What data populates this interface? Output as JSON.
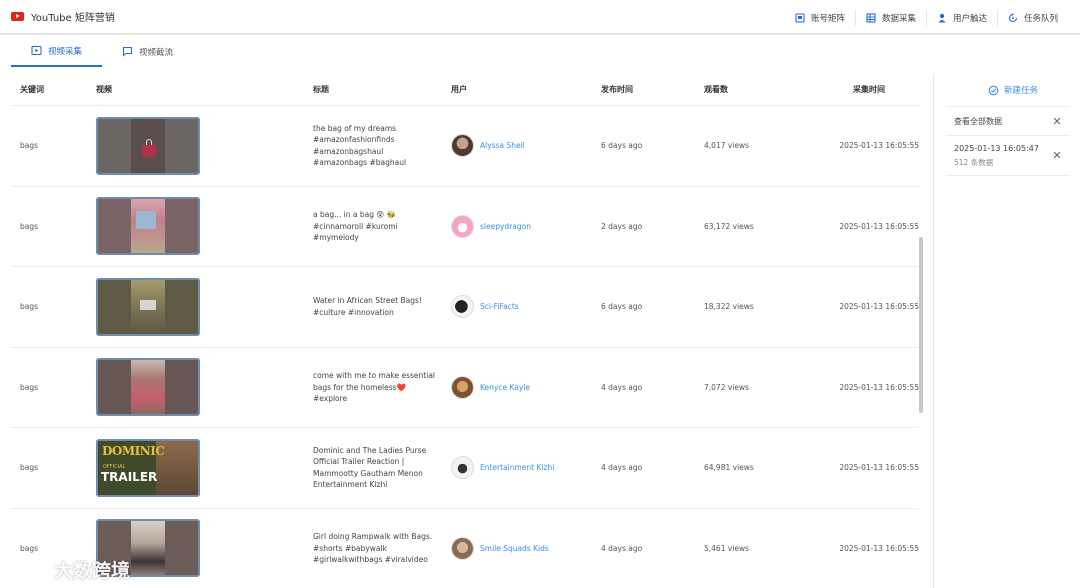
{
  "header": {
    "title": "YouTube 矩阵营销",
    "nav": [
      {
        "label": "账号矩阵",
        "icon": "account-matrix-icon"
      },
      {
        "label": "数据采集",
        "icon": "data-collection-icon"
      },
      {
        "label": "用户触达",
        "icon": "user-reach-icon"
      },
      {
        "label": "任务队列",
        "icon": "task-queue-icon"
      }
    ]
  },
  "tabs": [
    {
      "label": "视频采集",
      "icon": "video-collect-icon",
      "active": true
    },
    {
      "label": "视频截流",
      "icon": "video-intercept-icon",
      "active": false
    }
  ],
  "table": {
    "columns": [
      "关键词",
      "视频",
      "标题",
      "用户",
      "发布时间",
      "观看数",
      "采集时间"
    ],
    "rows": [
      {
        "keyword": "bags",
        "title": [
          "the bag of my dreams",
          "#amazonfashionfinds",
          "#amazonbagshaul",
          "#amazonbags #baghaul"
        ],
        "user": "Alyssa Sheil",
        "published": "6 days ago",
        "views": "4,017 views",
        "collected": "2025-01-13 16:05:55"
      },
      {
        "keyword": "bags",
        "title": [
          "a bag... in a bag 😵 🐝",
          "#cinnamoroll #kuromi",
          "#mymelody"
        ],
        "user": "sleepydragon",
        "published": "2 days ago",
        "views": "63,172 views",
        "collected": "2025-01-13 16:05:55"
      },
      {
        "keyword": "bags",
        "title": [
          "Water in African Street Bags!",
          "#culture #innovation"
        ],
        "user": "Sci-FiFacts",
        "published": "6 days ago",
        "views": "18,322 views",
        "collected": "2025-01-13 16:05:55"
      },
      {
        "keyword": "bags",
        "title": [
          "come with me to make essential",
          "bags for the homeless❤️",
          "#explore"
        ],
        "user": "Kenyce Kayle",
        "published": "4 days ago",
        "views": "7,072 views",
        "collected": "2025-01-13 16:05:55"
      },
      {
        "keyword": "bags",
        "title": [
          "Dominic and The Ladies Purse",
          "Official Trailer Reaction |",
          "Mammootty Gautham Menon",
          "Entertainment Kizhi"
        ],
        "user": "Entertainment Kizhi",
        "published": "4 days ago",
        "views": "64,981 views",
        "collected": "2025-01-13 16:05:55",
        "thumb_text": [
          "DOMINIC",
          "OFFICIAL",
          "TRAILER"
        ]
      },
      {
        "keyword": "bags",
        "title": [
          "Girl doing Rampwalk with Bags.",
          "#shorts #babywalk",
          "#girlwalkwithbags #viralvideo"
        ],
        "user": "Smile Squads Kids",
        "published": "4 days ago",
        "views": "5,461 views",
        "collected": "2025-01-13 16:05:55"
      }
    ]
  },
  "right_panel": {
    "new_task": "新建任务",
    "tasks": [
      {
        "label": "查看全部数据"
      },
      {
        "label": "2025-01-13 16:05:47",
        "sub": "512 条数据"
      }
    ]
  },
  "watermark": {
    "text": "大数跨境"
  },
  "colors": {
    "accent": "#2d6cc7",
    "link": "#3a8ee6",
    "youtube_red": "#e62117"
  }
}
